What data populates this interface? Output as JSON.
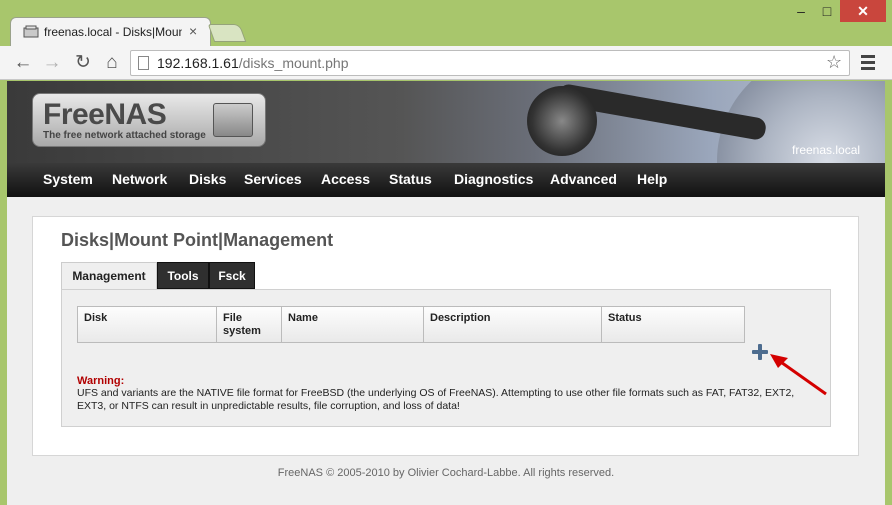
{
  "browser": {
    "tab_title": "freenas.local - Disks|Moun",
    "close_glyph": "×",
    "url_host": "192.168.1.61",
    "url_path": "/disks_mount.php",
    "window_controls": {
      "minimize": "‒",
      "maximize": "□",
      "close": "✕"
    }
  },
  "header": {
    "logo_text": "FreeNAS",
    "logo_tagline": "The free network attached storage",
    "hostname": "freenas.local"
  },
  "menu": [
    {
      "label": "System"
    },
    {
      "label": "Network"
    },
    {
      "label": "Disks"
    },
    {
      "label": "Services"
    },
    {
      "label": "Access"
    },
    {
      "label": "Status"
    },
    {
      "label": "Diagnostics"
    },
    {
      "label": "Advanced"
    },
    {
      "label": "Help"
    }
  ],
  "content": {
    "title": "Disks|Mount Point|Management",
    "tabs": [
      {
        "label": "Management",
        "active": true
      },
      {
        "label": "Tools",
        "active": false
      },
      {
        "label": "Fsck",
        "active": false
      }
    ],
    "columns": [
      "Disk",
      "File system",
      "Name",
      "Description",
      "Status"
    ],
    "warning_title": "Warning:",
    "warning_text": "UFS and variants are the NATIVE file format for FreeBSD (the underlying OS of FreeNAS). Attempting to use other file formats such as FAT, FAT32, EXT2, EXT3, or NTFS can result in unpredictable results, file corruption, and loss of data!"
  },
  "footer": {
    "text": "FreeNAS © 2005-2010 by Olivier Cochard-Labbe. All rights reserved."
  },
  "colors": {
    "window_frame": "#a8c66c",
    "menubar": "#1e1e1e",
    "warning": "#b10000",
    "add_icon": "#4d6c8f",
    "annotation_arrow": "#d40000"
  }
}
